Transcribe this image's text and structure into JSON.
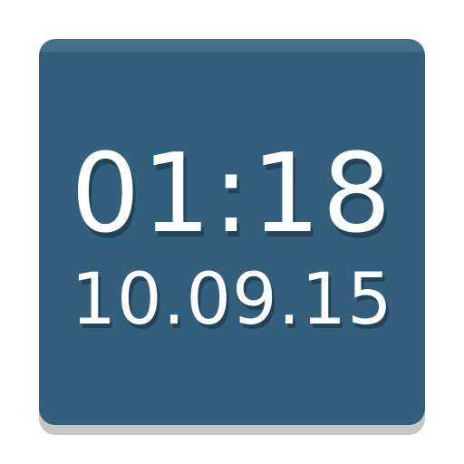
{
  "clock": {
    "time": "01:18",
    "date": "10.09.15"
  },
  "colors": {
    "tile_background": "#325f7c",
    "text": "#ffffff",
    "shadow": "#c6c6c6"
  }
}
